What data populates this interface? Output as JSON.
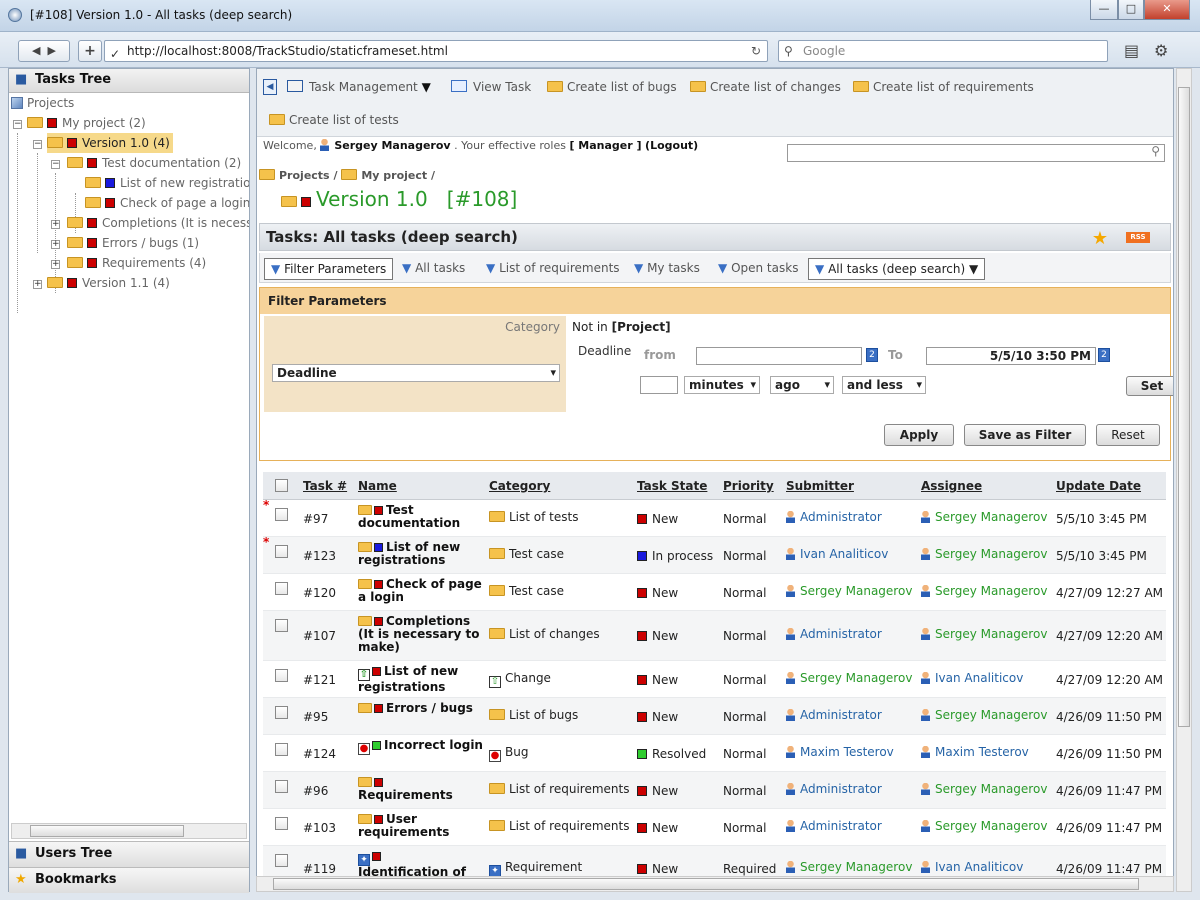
{
  "window": {
    "title": "[#108] Version 1.0 - All tasks (deep search)"
  },
  "browser": {
    "url": "http://localhost:8008/TrackStudio/staticframeset.html",
    "search_placeholder": "Google"
  },
  "left": {
    "tree_title": "Tasks Tree",
    "users_tree": "Users Tree",
    "bookmarks": "Bookmarks",
    "nodes": [
      {
        "label": "Projects"
      },
      {
        "label": "My project (2)"
      },
      {
        "label": "Version 1.0 (4)"
      },
      {
        "label": "Test documentation (2)"
      },
      {
        "label": "List of new registrations"
      },
      {
        "label": "Check of page a login"
      },
      {
        "label": "Completions (It is necessary"
      },
      {
        "label": "Errors / bugs (1)"
      },
      {
        "label": "Requirements (4)"
      },
      {
        "label": "Version 1.1 (4)"
      }
    ]
  },
  "menu": {
    "items": [
      {
        "label": "Task Management"
      },
      {
        "label": "View Task"
      },
      {
        "label": "Create list of bugs"
      },
      {
        "label": "Create list of changes"
      },
      {
        "label": "Create list of requirements"
      },
      {
        "label": "Create list of tests"
      }
    ]
  },
  "welcome": {
    "prefix": "Welcome,",
    "user": "Sergey Managerov",
    "roles_text": ". Your effective roles",
    "role": "[ Manager ]",
    "logout": "(Logout)"
  },
  "breadcrumb": {
    "projects": "Projects",
    "sep": "/",
    "project": "My project"
  },
  "page": {
    "title": "Version 1.0",
    "id": "[#108]"
  },
  "tasks_header": "Tasks: All tasks (deep search)",
  "rss": "RSS",
  "filters": {
    "tabs": [
      "Filter Parameters",
      "All tasks",
      "List of requirements",
      "My tasks",
      "Open tasks",
      "All tasks (deep search)"
    ]
  },
  "filter_panel": {
    "title": "Filter Parameters",
    "category_label": "Category",
    "category_value": "Not in",
    "category_bold": "[Project]",
    "deadline_label": "Deadline",
    "deadline_select": "Deadline",
    "from_label": "from",
    "to_label": "To",
    "from_value": "",
    "to_value": "5/5/10 3:50 PM",
    "minutes_value": "",
    "unit": "minutes",
    "direction": "ago",
    "comparison": "and less",
    "set_btn": "Set",
    "apply_btn": "Apply",
    "save_btn": "Save as Filter",
    "reset_btn": "Reset"
  },
  "grid": {
    "headers": [
      "Task #",
      "Name",
      "Category",
      "Task State",
      "Priority",
      "Submitter",
      "Assignee",
      "Update Date"
    ],
    "rows": [
      {
        "num": "#97",
        "name": "Test documentation",
        "category": "List of tests",
        "state": "New",
        "priority": "Normal",
        "submitter": "Administrator",
        "assignee": "Sergey Managerov",
        "date": "5/5/10 3:45 PM"
      },
      {
        "num": "#123",
        "name": "List of new registrations",
        "category": "Test case",
        "state": "In process",
        "priority": "Normal",
        "submitter": "Ivan Analiticov",
        "assignee": "Sergey Managerov",
        "date": "5/5/10 3:45 PM"
      },
      {
        "num": "#120",
        "name": "Check of page a login",
        "category": "Test case",
        "state": "New",
        "priority": "Normal",
        "submitter": "Sergey Managerov",
        "assignee": "Sergey Managerov",
        "date": "4/27/09 12:27 AM"
      },
      {
        "num": "#107",
        "name": "Completions (It is necessary to make)",
        "category": "List of changes",
        "state": "New",
        "priority": "Normal",
        "submitter": "Administrator",
        "assignee": "Sergey Managerov",
        "date": "4/27/09 12:20 AM"
      },
      {
        "num": "#121",
        "name": "List of new registrations",
        "category": "Change",
        "state": "New",
        "priority": "Normal",
        "submitter": "Sergey Managerov",
        "assignee": "Ivan Analiticov",
        "date": "4/27/09 12:20 AM"
      },
      {
        "num": "#95",
        "name": "Errors / bugs",
        "category": "List of bugs",
        "state": "New",
        "priority": "Normal",
        "submitter": "Administrator",
        "assignee": "Sergey Managerov",
        "date": "4/26/09 11:50 PM"
      },
      {
        "num": "#124",
        "name": "Incorrect login",
        "category": "Bug",
        "state": "Resolved",
        "priority": "Normal",
        "submitter": "Maxim Testerov",
        "assignee": "Maxim Testerov",
        "date": "4/26/09 11:50 PM"
      },
      {
        "num": "#96",
        "name": "Requirements",
        "category": "List of requirements",
        "state": "New",
        "priority": "Normal",
        "submitter": "Administrator",
        "assignee": "Sergey Managerov",
        "date": "4/26/09 11:47 PM"
      },
      {
        "num": "#103",
        "name": "User requirements",
        "category": "List of requirements",
        "state": "New",
        "priority": "Normal",
        "submitter": "Administrator",
        "assignee": "Sergey Managerov",
        "date": "4/26/09 11:47 PM"
      },
      {
        "num": "#119",
        "name": "Identification of",
        "category": "Requirement",
        "state": "New",
        "priority": "Required",
        "submitter": "Sergey Managerov",
        "assignee": "Ivan Analiticov",
        "date": "4/26/09 11:47 PM"
      }
    ]
  },
  "colors": {
    "accent_green": "#2a9a2a",
    "link_blue": "#2563a6",
    "state_new": "#c00000",
    "state_in_process": "#1a1add",
    "state_resolved": "#2fcc2f"
  }
}
